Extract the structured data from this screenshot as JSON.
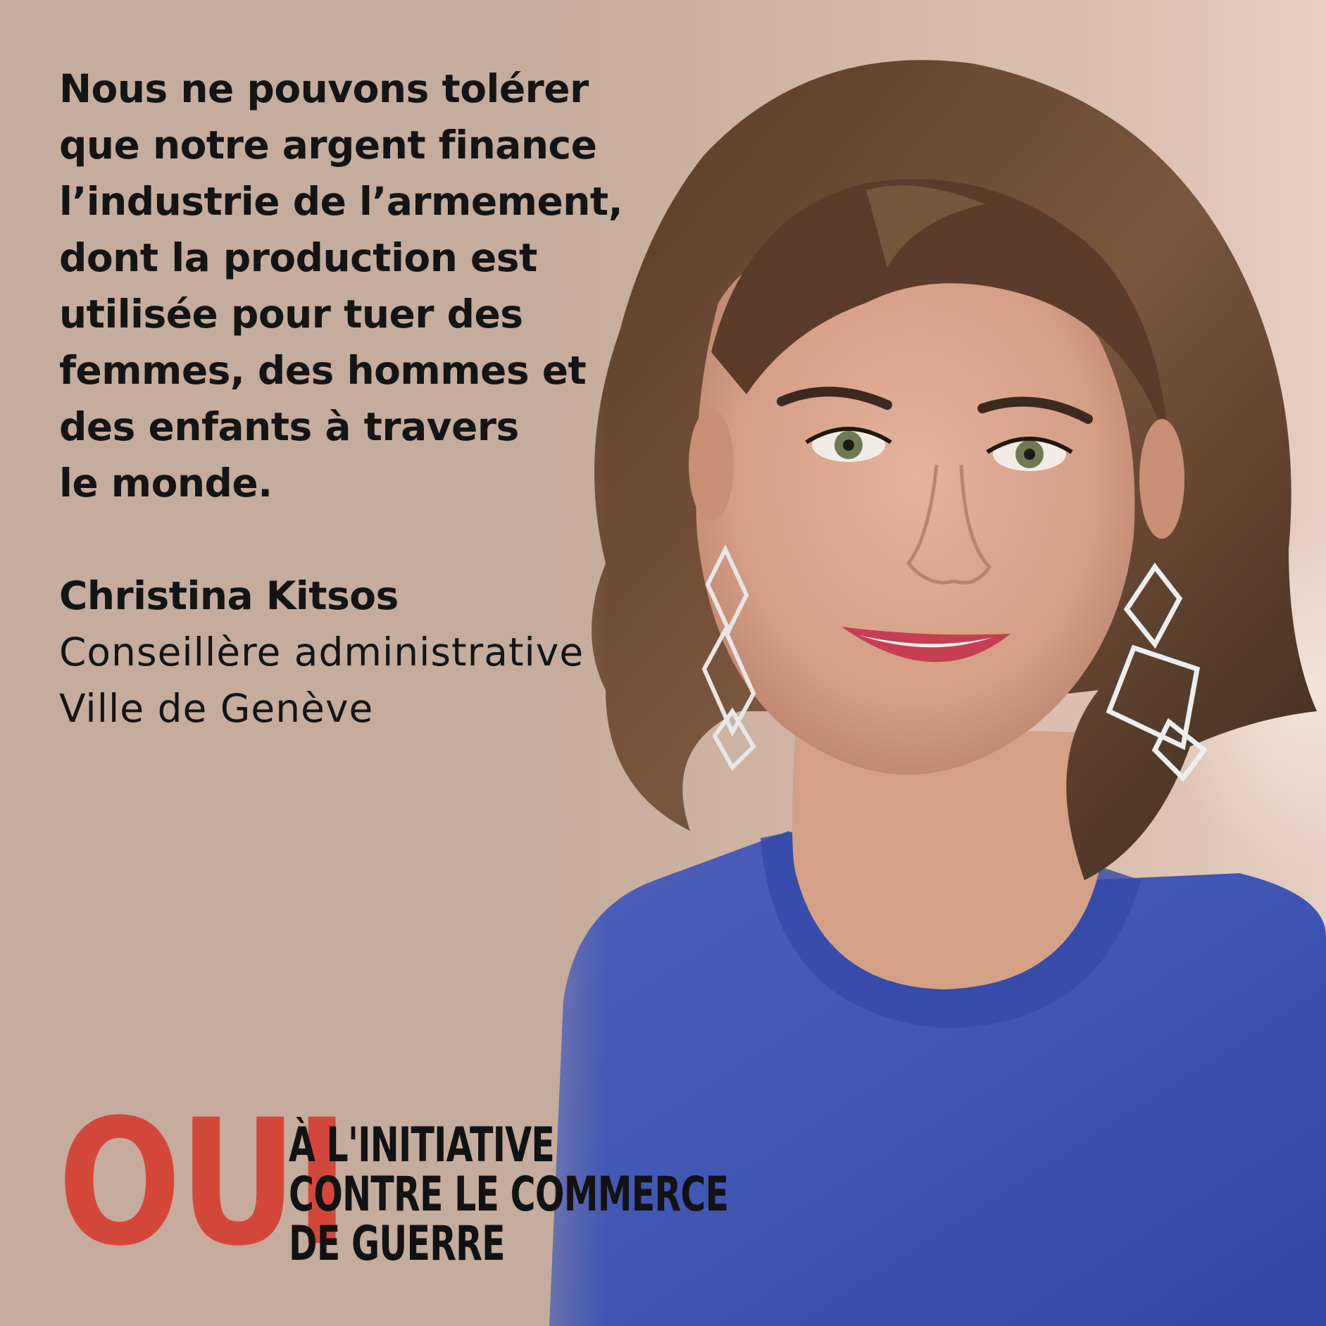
{
  "quote": {
    "lines": [
      "Nous ne pouvons tolérer",
      "que notre argent finance",
      "l’industrie de l’armement,",
      "dont la production est",
      "utilisée pour tuer des",
      "femmes, des hommes et",
      "des enfants à travers",
      "le monde."
    ]
  },
  "author": {
    "name": "Christina Kitsos",
    "role": "Conseillère administrative",
    "city": "Ville de Genève"
  },
  "logo": {
    "oui": "OUI",
    "lines": [
      "À L'INITIATIVE",
      "CONTRE LE COMMERCE",
      "DE GUERRE"
    ]
  },
  "colors": {
    "background": "#c6ac9c",
    "text": "#141414",
    "accent_red": "#d3473b",
    "shirt_blue": "#3f58b3"
  }
}
